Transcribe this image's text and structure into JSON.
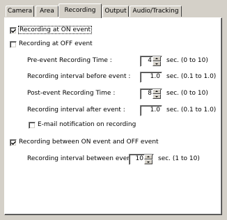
{
  "tabs": [
    {
      "label": "Camera"
    },
    {
      "label": "Area"
    },
    {
      "label": "Recording"
    },
    {
      "label": "Output"
    },
    {
      "label": "Audio/Tracking"
    }
  ],
  "active_tab": "Recording",
  "on_event": {
    "label": "Recording at ON event",
    "checked": true
  },
  "off_event": {
    "label": "Recording at OFF event",
    "checked": false
  },
  "pre_time": {
    "label": "Pre-event Recording Time :",
    "value": "4",
    "unit": "sec. (0 to 10)"
  },
  "interval_before": {
    "label": "Recording interval before event :",
    "value": "1.0",
    "unit": "sec. (0.1 to 1.0)"
  },
  "post_time": {
    "label": "Post-event Recording Time :",
    "value": "8",
    "unit": "sec. (0 to 10)"
  },
  "interval_after": {
    "label": "Recording interval after event :",
    "value": "1.0",
    "unit": "sec. (0.1 to 1.0)"
  },
  "email_notify": {
    "label": "E-mail notification on recording",
    "checked": false
  },
  "between_events": {
    "label": "Recording between ON event and OFF event",
    "checked": true
  },
  "interval_between": {
    "label": "Recording interval between events :",
    "value": "10",
    "unit": "sec. (1 to 10)"
  }
}
